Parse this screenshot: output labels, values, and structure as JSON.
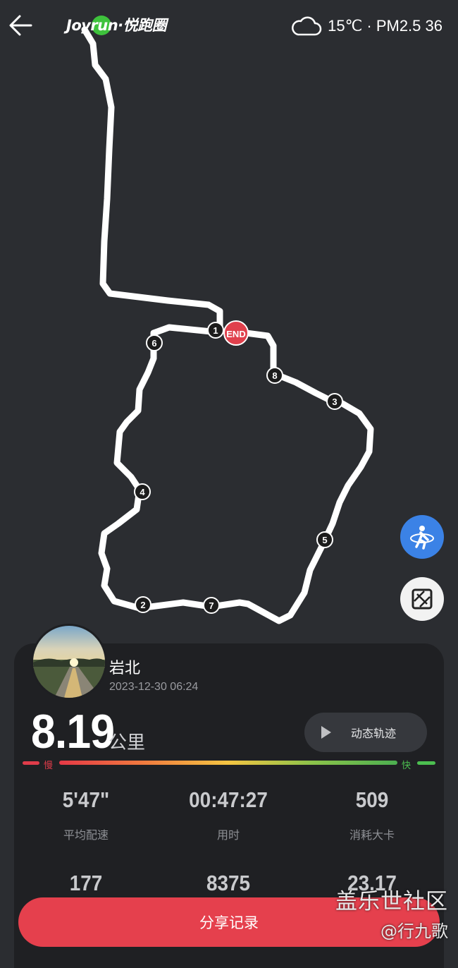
{
  "header": {
    "logo_text": "Joyrun·悦跑圈",
    "weather_icon": "cloud-icon",
    "weather_text": "15℃ · PM2.5 36"
  },
  "map": {
    "end_label": "END",
    "markers": [
      "1",
      "2",
      "3",
      "4",
      "5",
      "6",
      "7",
      "8"
    ]
  },
  "record": {
    "place": "岩北",
    "datetime": "2023-12-30 06:24",
    "distance": "8.19",
    "distance_unit": "公里",
    "replay_label": "动态轨迹",
    "pace_slow_label": "慢",
    "pace_fast_label": "快",
    "stats_row1": [
      {
        "value": "5'47\"",
        "label": "平均配速"
      },
      {
        "value": "00:47:27",
        "label": "用时"
      },
      {
        "value": "509",
        "label": "消耗大卡"
      }
    ],
    "stats_row2": [
      {
        "value": "177"
      },
      {
        "value": "8375"
      },
      {
        "value": "23.17"
      }
    ]
  },
  "share_label": "分享记录",
  "watermark": {
    "line1": "盖乐世社区",
    "line2": "@行九歌"
  },
  "colors": {
    "background": "#2b2d31",
    "card": "#1f2023",
    "accent_red": "#e5404d",
    "run_button_blue": "#3b82e6"
  }
}
